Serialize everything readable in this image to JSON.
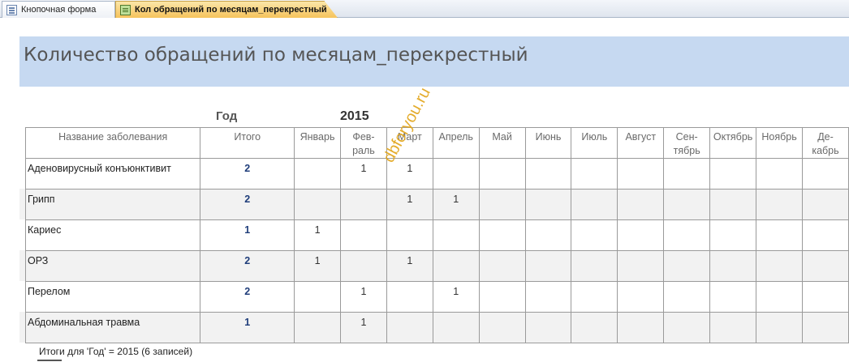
{
  "tabs": [
    {
      "label": "Кнопочная форма",
      "icon": "form-icon"
    },
    {
      "label": "Кол обращений по месяцам_перекрестный",
      "icon": "report-icon"
    }
  ],
  "report": {
    "title": "Количество обращений по месяцам_перекрестный",
    "year_label": "Год",
    "year_value": "2015",
    "columns": [
      "Название заболевания",
      "Итого",
      "Январь",
      "Фев-\nраль",
      "Март",
      "Апрель",
      "Май",
      "Июнь",
      "Июль",
      "Август",
      "Сен-\nтябрь",
      "Октябрь",
      "Ноябрь",
      "Де-\nкабрь"
    ],
    "rows": [
      {
        "name": "Аденовирусный конъюнктивит",
        "total": "2",
        "months": [
          "",
          "1",
          "1",
          "",
          "",
          "",
          "",
          "",
          "",
          "",
          "",
          ""
        ]
      },
      {
        "name": "Грипп",
        "total": "2",
        "months": [
          "",
          "",
          "1",
          "1",
          "",
          "",
          "",
          "",
          "",
          "",
          "",
          ""
        ]
      },
      {
        "name": "Кариес",
        "total": "1",
        "months": [
          "1",
          "",
          "",
          "",
          "",
          "",
          "",
          "",
          "",
          "",
          "",
          ""
        ]
      },
      {
        "name": "ОРЗ",
        "total": "2",
        "months": [
          "1",
          "",
          "1",
          "",
          "",
          "",
          "",
          "",
          "",
          "",
          "",
          ""
        ]
      },
      {
        "name": "Перелом",
        "total": "2",
        "months": [
          "",
          "1",
          "",
          "1",
          "",
          "",
          "",
          "",
          "",
          "",
          "",
          ""
        ]
      },
      {
        "name": "Абдоминальная травма",
        "total": "1",
        "months": [
          "",
          "1",
          "",
          "",
          "",
          "",
          "",
          "",
          "",
          "",
          "",
          ""
        ]
      }
    ],
    "footer": "Итоги для 'Год' =  2015 (6 записей)"
  },
  "watermark": "dbforyou.ru",
  "colors": {
    "header_band": "#c6d9f1",
    "active_tab": "#f6c35c",
    "alt_row": "#f2f2f2",
    "total_text": "#1f3d7a",
    "watermark": "#e2a416"
  }
}
